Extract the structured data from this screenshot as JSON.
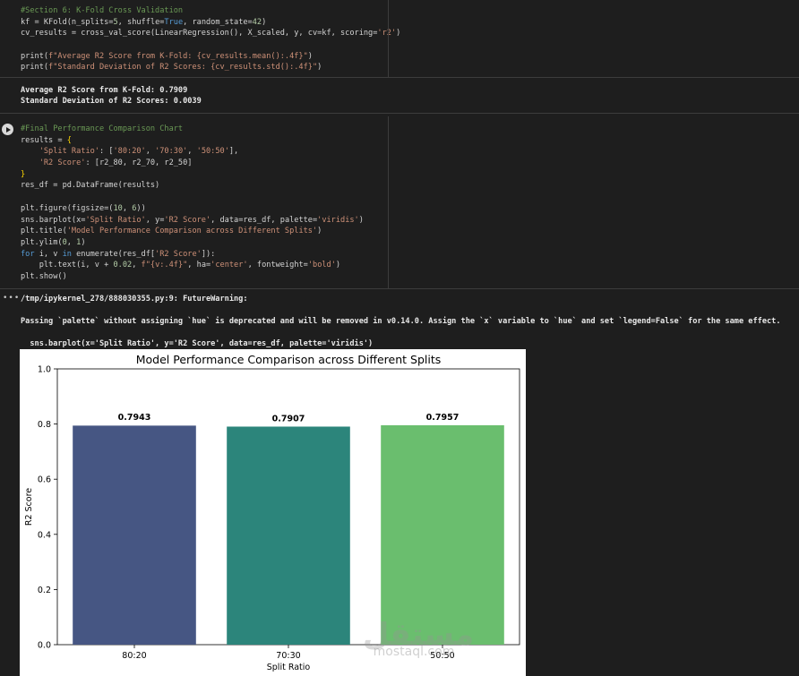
{
  "cell1": {
    "lines": [
      "#Section 6: K-Fold Cross Validation",
      "kf = KFold(n_splits=5, shuffle=True, random_state=42)",
      "cv_results = cross_val_score(LinearRegression(), X_scaled, y, cv=kf, scoring='r2')",
      "",
      "print(f\"Average R2 Score from K-Fold: {cv_results.mean():.4f}\")",
      "print(f\"Standard Deviation of R2 Scores: {cv_results.std():.4f}\")"
    ],
    "output": [
      "Average R2 Score from K-Fold: 0.7909",
      "Standard Deviation of R2 Scores: 0.0039"
    ]
  },
  "cell2": {
    "lines": [
      "#Final Performance Comparison Chart",
      "results = {",
      "    'Split Ratio': ['80:20', '70:30', '50:50'],",
      "    'R2 Score': [r2_80, r2_70, r2_50]",
      "}",
      "res_df = pd.DataFrame(results)",
      "",
      "plt.figure(figsize=(10, 6))",
      "sns.barplot(x='Split Ratio', y='R2 Score', data=res_df, palette='viridis')",
      "plt.title('Model Performance Comparison across Different Splits')",
      "plt.ylim(0, 1)",
      "for i, v in enumerate(res_df['R2 Score']):",
      "    plt.text(i, v + 0.02, f\"{v:.4f}\", ha='center', fontweight='bold')",
      "plt.show()"
    ],
    "output_menu": "•••",
    "warning": [
      "/tmp/ipykernel_278/888030355.py:9: FutureWarning:",
      "Passing `palette` without assigning `hue` is deprecated and will be removed in v0.14.0. Assign the `x` variable to `hue` and set `legend=False` for the same effect.",
      "  sns.barplot(x='Split Ratio', y='R2 Score', data=res_df, palette='viridis')"
    ]
  },
  "chart_data": {
    "type": "bar",
    "title": "Model Performance Comparison across Different Splits",
    "xlabel": "Split Ratio",
    "ylabel": "R2 Score",
    "categories": [
      "80:20",
      "70:30",
      "50:50"
    ],
    "values": [
      0.7943,
      0.7907,
      0.7957
    ],
    "data_labels": [
      "0.7943",
      "0.7907",
      "0.7957"
    ],
    "colors": [
      "#482878",
      "#21918c",
      "#5ec962"
    ],
    "bar_colors_rendered": [
      "#465683",
      "#2c857b",
      "#6abe6e"
    ],
    "ylim": [
      0,
      1
    ],
    "yticks": [
      "0.0",
      "0.2",
      "0.4",
      "0.6",
      "0.8",
      "1.0"
    ],
    "grid": false,
    "legend": "none"
  },
  "watermark": {
    "text": "mostaql.com",
    "arabic": "مستقل"
  }
}
